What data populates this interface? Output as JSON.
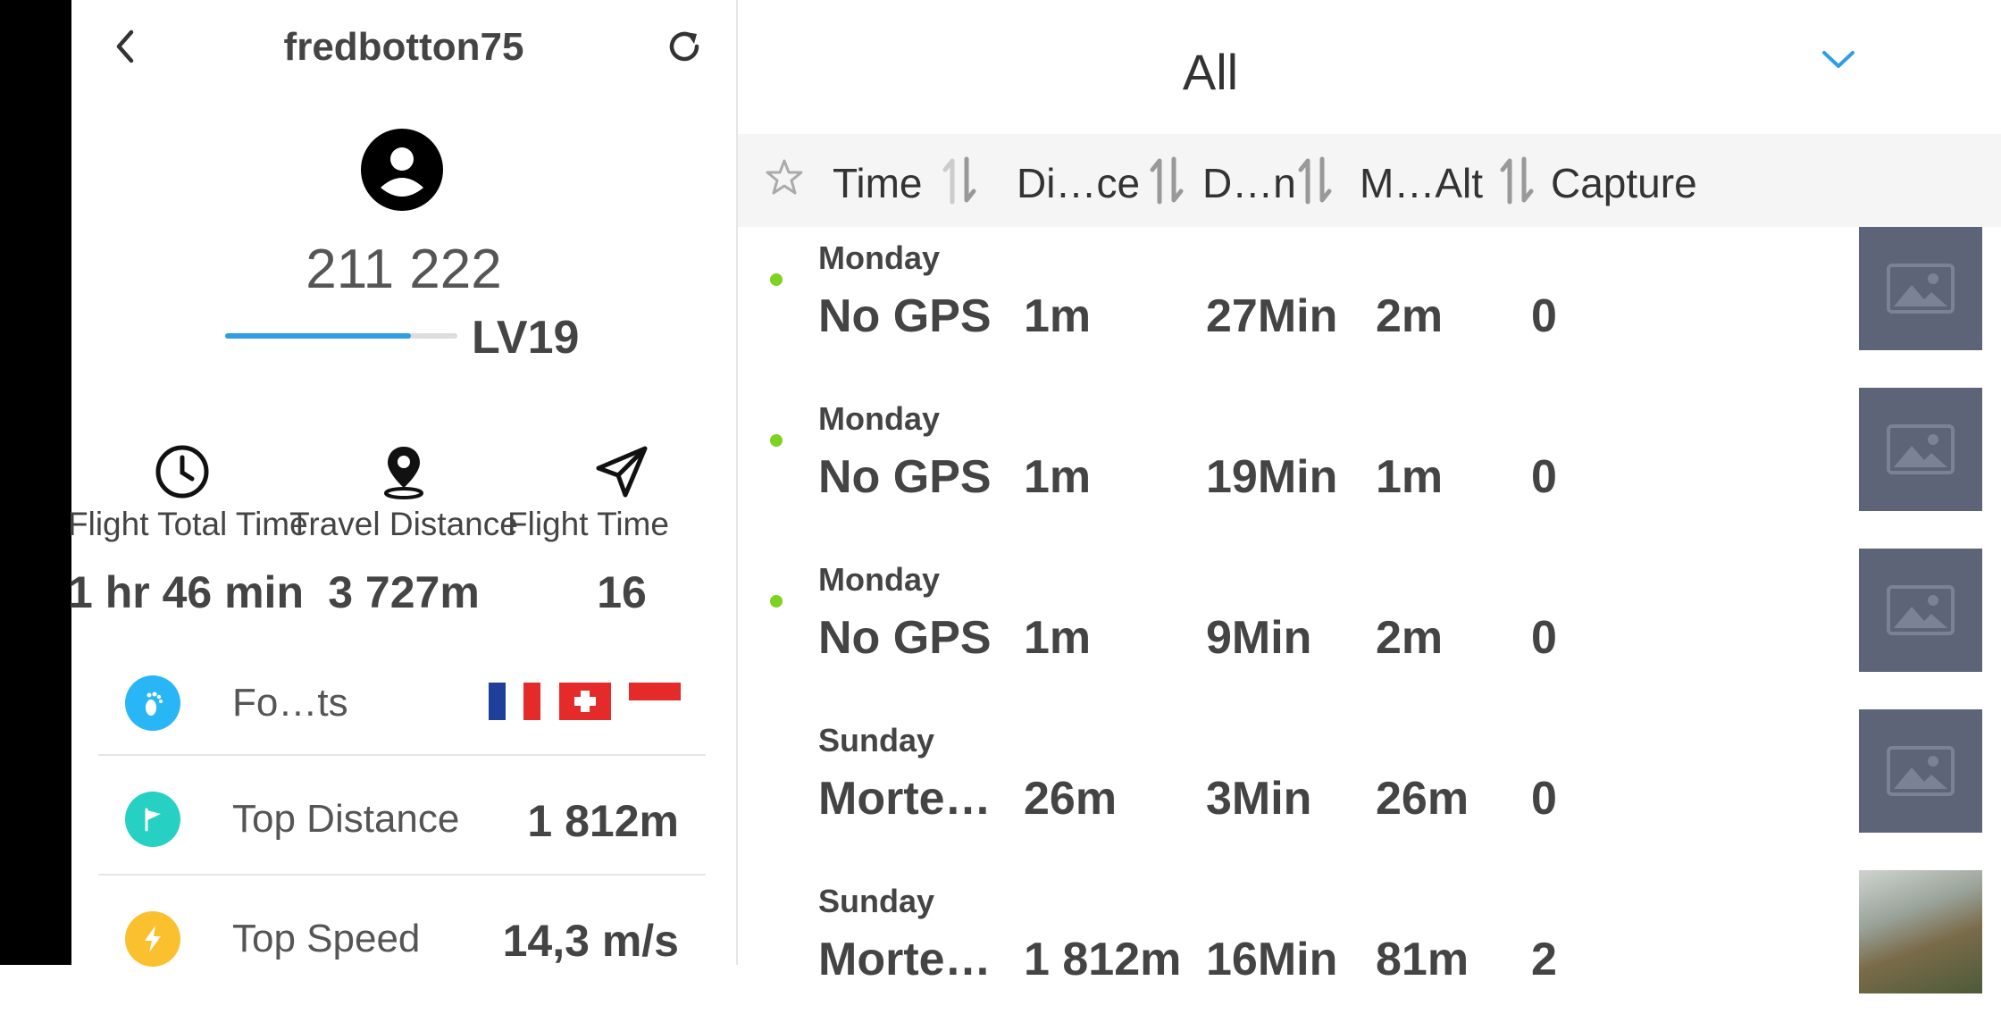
{
  "profile": {
    "username": "fredbotton75",
    "points": "211 222",
    "level": "LV19",
    "level_progress": 0.8
  },
  "stats": [
    {
      "icon": "clock-icon",
      "label": "Flight Total Time",
      "value": "1 hr 46 min"
    },
    {
      "icon": "location-pin-icon",
      "label": "Travel Distance",
      "value": "3 727m"
    },
    {
      "icon": "paper-plane-icon",
      "label": "Flight Time",
      "value": "16"
    }
  ],
  "records": [
    {
      "icon": "footprint-icon",
      "color": "#29b6f6",
      "label": "Fo…ts",
      "flags": [
        "France",
        "Switzerland",
        "Indonesia"
      ]
    },
    {
      "icon": "flag-icon",
      "color": "#26d0c2",
      "label": "Top Distance",
      "value": "1 812m"
    },
    {
      "icon": "lightning-icon",
      "color": "#fbc02d",
      "label": "Top Speed",
      "value": "14,3 m/s"
    }
  ],
  "filter": {
    "selected": "All"
  },
  "columns": {
    "time": "Time",
    "distance": "Di…ce",
    "duration": "D…n",
    "max_alt": "M…Alt",
    "capture": "Capture"
  },
  "flights": [
    {
      "day": "Monday",
      "location": "No GPS",
      "distance": "1m",
      "duration": "27Min",
      "altitude": "2m",
      "captures": "0",
      "synced": true
    },
    {
      "day": "Monday",
      "location": "No GPS",
      "distance": "1m",
      "duration": "19Min",
      "altitude": "1m",
      "captures": "0",
      "synced": true
    },
    {
      "day": "Monday",
      "location": "No GPS",
      "distance": "1m",
      "duration": "9Min",
      "altitude": "2m",
      "captures": "0",
      "synced": true
    },
    {
      "day": "Sunday",
      "location": "Morte…",
      "distance": "26m",
      "duration": "3Min",
      "altitude": "26m",
      "captures": "0",
      "synced": false
    },
    {
      "day": "Sunday",
      "location": "Morte…",
      "distance": "1 812m",
      "duration": "16Min",
      "altitude": "81m",
      "captures": "2",
      "synced": false
    }
  ],
  "colors": {
    "accent": "#2f9ee6",
    "synced_dot": "#7ed321",
    "thumb_placeholder": "#5d6478"
  }
}
